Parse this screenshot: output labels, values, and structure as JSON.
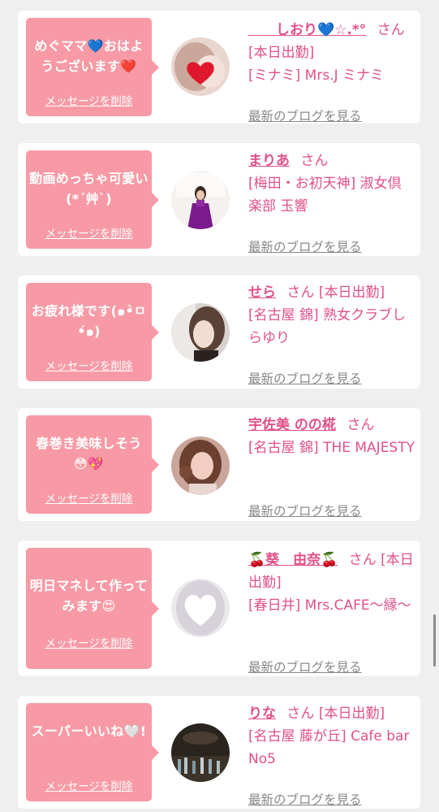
{
  "items": [
    {
      "message": "めぐママ💙おはようございます❤️",
      "delete_label": "メッセージを削除",
      "name": "　　しおり💙☆.*°",
      "suffix": "さん",
      "status": "[本日出勤]",
      "shop": "[ミナミ] Mrs.J ミナミ",
      "blog_label": "最新のブログを見る"
    },
    {
      "message": "動画めっちゃ可愛い(*´艸`)",
      "delete_label": "メッセージを削除",
      "name": "まりあ",
      "suffix": "さん",
      "status": "",
      "shop": "[梅田・お初天神] 淑女倶楽部 玉響",
      "blog_label": "最新のブログを見る"
    },
    {
      "message": "お疲れ様です(๑•̀ㅁ•́๑)",
      "delete_label": "メッセージを削除",
      "name": "せら",
      "suffix": "さん",
      "status": "[本日出勤]",
      "shop": "[名古屋 錦] 熟女クラブしらゆり",
      "blog_label": "最新のブログを見る"
    },
    {
      "message": "春巻き美味しそう😳💖",
      "delete_label": "メッセージを削除",
      "name": "宇佐美 のの椛",
      "suffix": "さん",
      "status": "",
      "shop": "[名古屋 錦] THE MAJESTY",
      "blog_label": "最新のブログを見る"
    },
    {
      "message": "明日マネして作ってみます😍",
      "delete_label": "メッセージを削除",
      "name": "🍒葵　由奈🍒",
      "suffix": "さん",
      "status": "[本日出勤]",
      "shop": "[春日井] Mrs.CAFE～縁～",
      "blog_label": "最新のブログを見る"
    },
    {
      "message": "スーパーいいね🤍!",
      "delete_label": "メッセージを削除",
      "name": "りな",
      "suffix": "さん",
      "status": "[本日出勤]",
      "shop": "[名古屋 藤が丘] Cafe bar No5",
      "blog_label": "最新のブログを見る"
    }
  ],
  "colors": {
    "bubble": "#f79aa5",
    "name": "#e0508a",
    "blog_link": "#888888",
    "background": "#efefef"
  }
}
